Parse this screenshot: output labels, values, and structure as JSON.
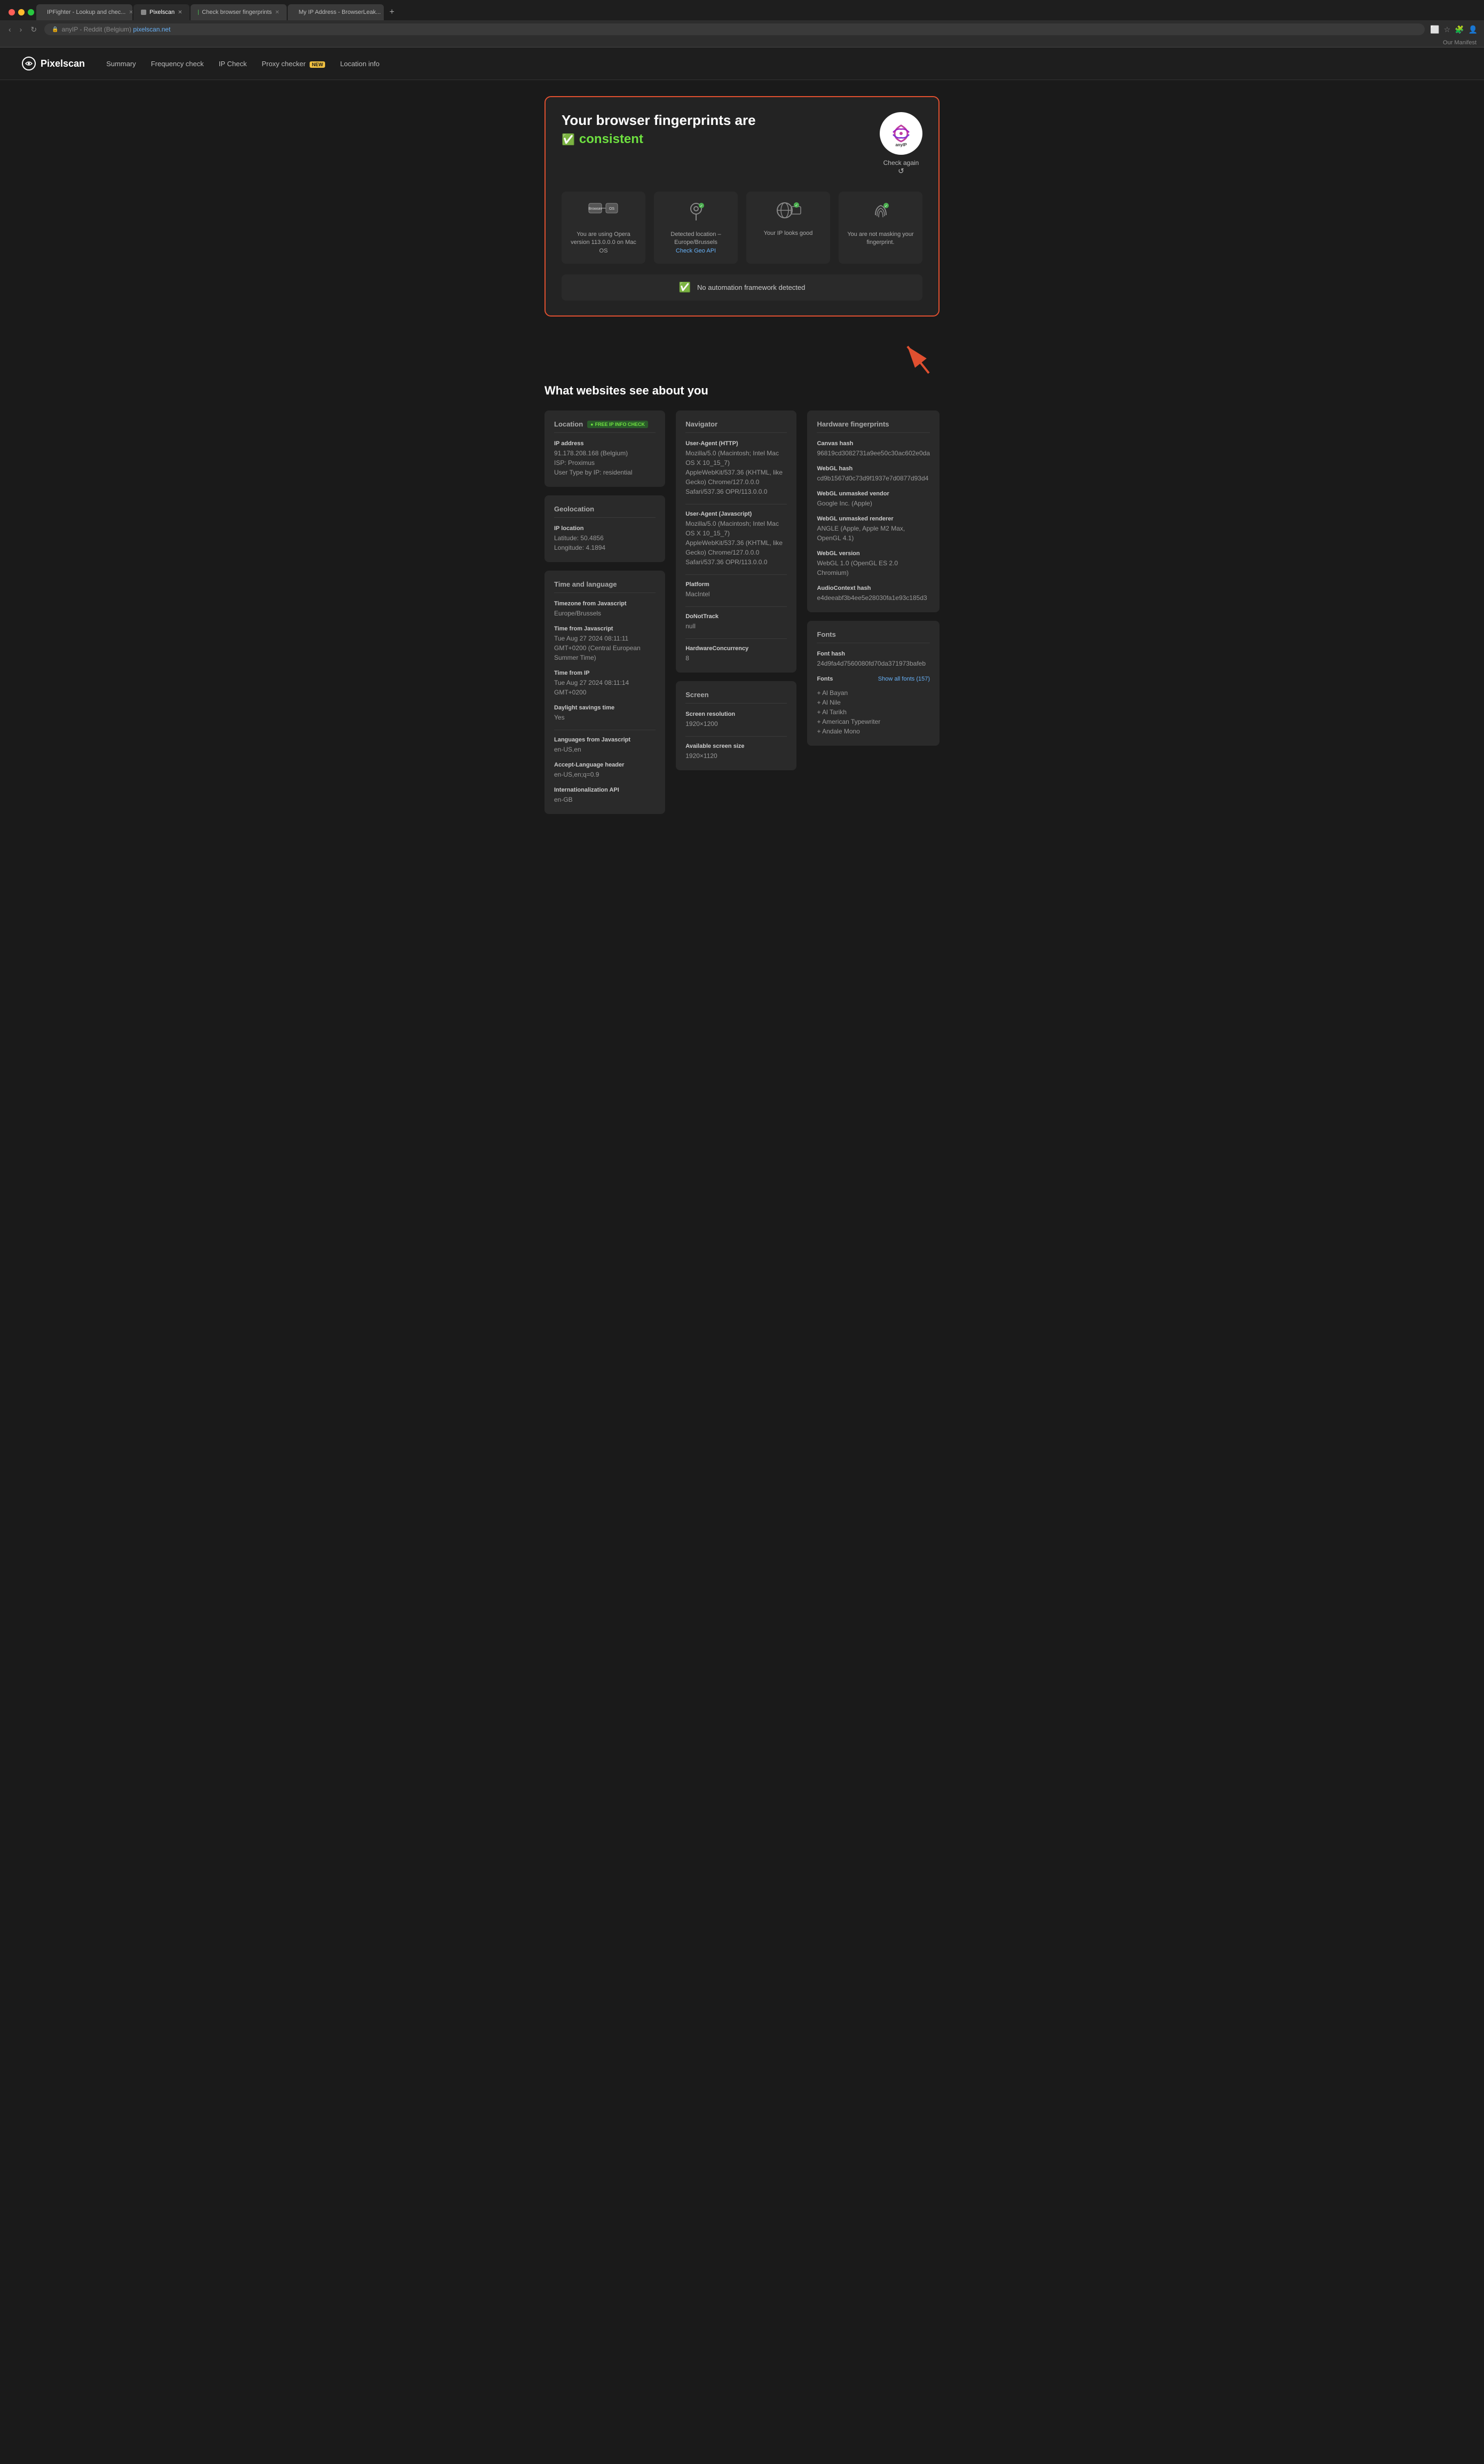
{
  "browser": {
    "tabs": [
      {
        "id": "tab1",
        "favicon_color": "#e05030",
        "label": "IPFighter - Lookup and chec...",
        "active": false
      },
      {
        "id": "tab2",
        "favicon_color": "#888",
        "label": "Pixelscan",
        "active": true
      },
      {
        "id": "tab3",
        "favicon_color": "#4caf50",
        "label": "Check browser fingerprints",
        "active": false
      },
      {
        "id": "tab4",
        "favicon_color": "#68b2f8",
        "label": "My IP Address - BrowserLeak...",
        "active": false
      }
    ],
    "url_prefix": "anyIP - Reddit (Belgium)",
    "url_main": "pixelscan.net",
    "manifest_text": "Our Manifest"
  },
  "header": {
    "logo_text": "Pixelscan",
    "nav": [
      {
        "label": "Summary",
        "badge": null
      },
      {
        "label": "Frequency check",
        "badge": null
      },
      {
        "label": "IP Check",
        "badge": null
      },
      {
        "label": "Proxy checker",
        "badge": "NEW"
      },
      {
        "label": "Location info",
        "badge": null
      }
    ]
  },
  "hero": {
    "title_line1": "Your browser fingerprints are",
    "title_line2": "consistent",
    "check_again": "Check again",
    "anyip_alt": "anyIP",
    "cards": [
      {
        "icon": "🖥",
        "text": "You are using Opera version 113.0.0.0 on Mac OS"
      },
      {
        "icon": "📍",
        "text": "Detected location – Europe/Brussels",
        "link": "Check Geo API"
      },
      {
        "icon": "🌐",
        "text": "Your IP looks good"
      },
      {
        "icon": "👆",
        "text": "You are not masking your fingerprint."
      }
    ],
    "automation_text": "No automation framework detected"
  },
  "what_section": {
    "title": "What websites see about you"
  },
  "location": {
    "section_title": "Location",
    "badge": "FREE IP INFO CHECK",
    "ip_label": "IP address",
    "ip_value": "91.178.208.168 (Belgium)",
    "isp_label": "ISP",
    "isp_value": "Proximus",
    "user_type_label": "User Type by IP",
    "user_type_value": "residential"
  },
  "geolocation": {
    "section_title": "Geolocation",
    "ip_location_label": "IP location",
    "latitude_label": "Latitude",
    "latitude_value": "50.4856",
    "longitude_label": "Longitude",
    "longitude_value": "4.1894"
  },
  "time_language": {
    "section_title": "Time and language",
    "tz_js_label": "Timezone from Javascript",
    "tz_js_value": "Europe/Brussels",
    "time_js_label": "Time from Javascript",
    "time_js_value": "Tue Aug 27 2024 08:11:11 GMT+0200 (Central European Summer Time)",
    "time_ip_label": "Time from IP",
    "time_ip_value": "Tue Aug 27 2024 08:11:14 GMT+0200",
    "dst_label": "Daylight savings time",
    "dst_value": "Yes",
    "lang_js_label": "Languages from Javascript",
    "lang_js_value": "en-US,en",
    "accept_lang_label": "Accept-Language header",
    "accept_lang_value": "en-US,en;q=0.9",
    "intl_api_label": "Internationalization API",
    "intl_api_value": "en-GB"
  },
  "navigator": {
    "section_title": "Navigator",
    "ua_http_label": "User-Agent (HTTP)",
    "ua_http_value": "Mozilla/5.0 (Macintosh; Intel Mac OS X 10_15_7) AppleWebKit/537.36 (KHTML, like Gecko) Chrome/127.0.0.0 Safari/537.36 OPR/113.0.0.0",
    "ua_js_label": "User-Agent (Javascript)",
    "ua_js_value": "Mozilla/5.0 (Macintosh; Intel Mac OS X 10_15_7) AppleWebKit/537.36 (KHTML, like Gecko) Chrome/127.0.0.0 Safari/537.36 OPR/113.0.0.0",
    "platform_label": "Platform",
    "platform_value": "MacIntel",
    "dnt_label": "DoNotTrack",
    "dnt_value": "null",
    "concurrency_label": "HardwareConcurrency",
    "concurrency_value": "8"
  },
  "screen": {
    "section_title": "Screen",
    "resolution_label": "Screen resolution",
    "resolution_value": "1920×1200",
    "available_label": "Available screen size",
    "available_value": "1920×1120"
  },
  "hardware": {
    "section_title": "Hardware fingerprints",
    "canvas_hash_label": "Canvas hash",
    "canvas_hash_value": "96819cd3082731a9ee50c30ac602e0da",
    "webgl_hash_label": "WebGL hash",
    "webgl_hash_value": "cd9b1567d0c73d9f1937e7d0877d93d4",
    "webgl_vendor_label": "WebGL unmasked vendor",
    "webgl_vendor_value": "Google Inc. (Apple)",
    "webgl_renderer_label": "WebGL unmasked renderer",
    "webgl_renderer_value": "ANGLE (Apple, Apple M2 Max, OpenGL 4.1)",
    "webgl_version_label": "WebGL version",
    "webgl_version_value": "WebGL 1.0 (OpenGL ES 2.0 Chromium)",
    "audio_hash_label": "AudioContext hash",
    "audio_hash_value": "e4deeabf3b4ee5e28030fa1e93c185d3"
  },
  "fonts": {
    "section_title": "Fonts",
    "hash_label": "Font hash",
    "hash_value": "24d9fa4d7560080fd70da371973bafeb",
    "fonts_label": "Fonts",
    "show_all": "Show all fonts (157)",
    "font_list": [
      "+ Al Bayan",
      "+ Al Nile",
      "+ Al Tarikh",
      "+ American Typewriter",
      "+ Andale Mono"
    ]
  },
  "icons": {
    "check": "✓",
    "refresh": "↺",
    "location_pin": "📍",
    "circle_check": "✅"
  }
}
